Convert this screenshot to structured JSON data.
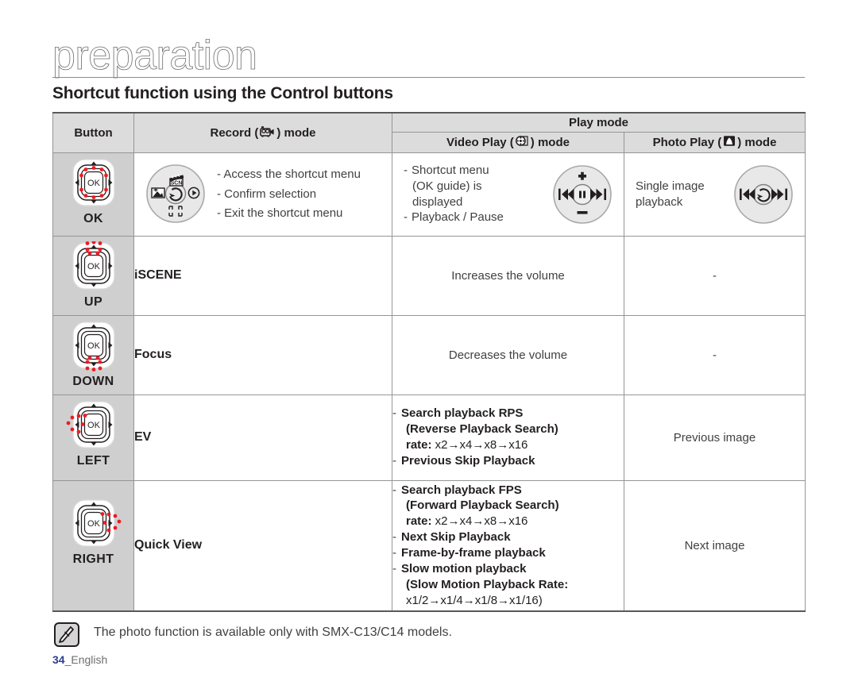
{
  "header": {
    "chapter_title": "preparation",
    "section_title": "Shortcut function using the Control buttons"
  },
  "table": {
    "columns": {
      "button": "Button",
      "record_prefix": "Record (",
      "record_suffix": ") mode",
      "play_mode": "Play mode",
      "video_prefix": "Video Play (",
      "video_suffix": ") mode",
      "photo_prefix": "Photo Play (",
      "photo_suffix": ") mode"
    },
    "icons": {
      "record": "camcorder-icon",
      "video_play": "film-reel-icon",
      "photo_play": "photo-icon"
    },
    "rows": [
      {
        "button_label": "OK",
        "dpad_highlight": "center",
        "record": {
          "type": "wheel_plus_list",
          "wheel": "shortcut-wheel-icon",
          "items": [
            "- Access the shortcut menu",
            "- Confirm selection",
            "- Exit the shortcut menu"
          ]
        },
        "video": {
          "type": "list_plus_wheel",
          "wheel": "playpause-wheel-icon",
          "items": [
            {
              "dash": "-",
              "text": "Shortcut menu"
            },
            {
              "dash": "",
              "text": "(OK guide) is"
            },
            {
              "dash": "",
              "text": "displayed"
            },
            {
              "dash": "-",
              "text": "Playback / Pause"
            }
          ]
        },
        "photo": {
          "type": "text_plus_wheel",
          "wheel": "skip-wheel-icon",
          "lines": [
            "Single image",
            "playback"
          ]
        }
      },
      {
        "button_label": "UP",
        "dpad_highlight": "up",
        "record": {
          "type": "plain",
          "text": "iSCENE"
        },
        "video": {
          "type": "center",
          "text": "Increases the volume"
        },
        "photo": {
          "type": "center",
          "text": "-"
        }
      },
      {
        "button_label": "DOWN",
        "dpad_highlight": "down",
        "record": {
          "type": "plain",
          "text": "Focus"
        },
        "video": {
          "type": "center",
          "text": "Decreases the volume"
        },
        "photo": {
          "type": "center",
          "text": "-"
        }
      },
      {
        "button_label": "LEFT",
        "dpad_highlight": "left",
        "record": {
          "type": "plain",
          "text": "EV"
        },
        "video": {
          "type": "boldlist",
          "items": [
            {
              "dash": "-",
              "bold": "Search playback RPS"
            },
            {
              "indent": true,
              "bold": "(Reverse Playback Search)"
            },
            {
              "indent": true,
              "bold": "rate:",
              "normal": " x2→x4→x8→x16"
            },
            {
              "dash": "-",
              "bold": "Previous Skip Playback"
            }
          ]
        },
        "photo": {
          "type": "center",
          "text": "Previous image"
        }
      },
      {
        "button_label": "RIGHT",
        "dpad_highlight": "right",
        "record": {
          "type": "plain",
          "text": "Quick View"
        },
        "video": {
          "type": "boldlist",
          "items": [
            {
              "dash": "-",
              "bold": "Search playback FPS"
            },
            {
              "indent": true,
              "bold": "(Forward Playback Search)"
            },
            {
              "indent": true,
              "bold": "rate:",
              "normal": " x2→x4→x8→x16"
            },
            {
              "dash": "-",
              "bold": "Next Skip Playback"
            },
            {
              "dash": "-",
              "bold": "Frame-by-frame playback"
            },
            {
              "dash": "-",
              "bold": "Slow motion playback"
            },
            {
              "indent": true,
              "bold": "(Slow Motion Playback Rate:"
            },
            {
              "indent": true,
              "normalonly": "x1/2→x1/4→x1/8→x1/16)"
            }
          ]
        },
        "photo": {
          "type": "center",
          "text": "Next image"
        }
      }
    ]
  },
  "footer": {
    "note_icon": "note-pen-icon",
    "note_text": "The photo function is available only with SMX-C13/C14 models.",
    "page_number": "34",
    "page_language": "_English"
  }
}
